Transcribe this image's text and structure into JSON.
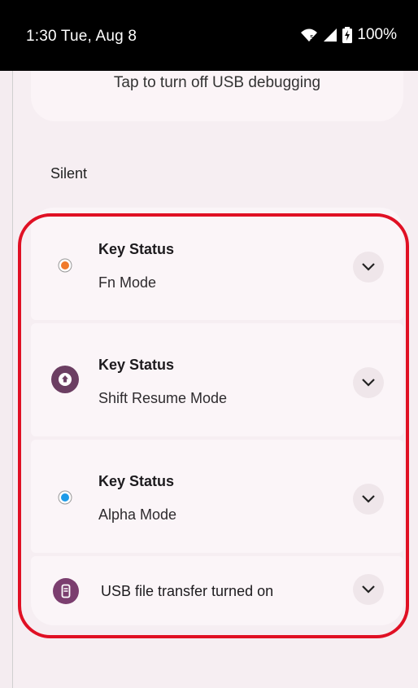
{
  "status_bar": {
    "time": "1:30 Tue, Aug 8",
    "battery": "100%",
    "icons": [
      "wifi-icon",
      "cellular-signal-icon",
      "battery-charging-icon"
    ]
  },
  "debug_card": {
    "text": "Tap to turn off USB debugging"
  },
  "section_label": "Silent",
  "notifications": [
    {
      "title": "Key Status",
      "text": "Fn Mode",
      "icon": "orange-dot-icon",
      "icon_color": "#f07a2a"
    },
    {
      "title": "Key Status",
      "text": "Shift Resume Mode",
      "icon": "shift-mode-icon",
      "icon_color": "#6b3e62"
    },
    {
      "title": "Key Status",
      "text": "Alpha Mode",
      "icon": "blue-dot-icon",
      "icon_color": "#1e9be8"
    },
    {
      "title": "",
      "text": "USB file transfer turned on",
      "icon": "usb-icon",
      "icon_color": "#7b3e6f"
    }
  ],
  "highlight_color": "#e01024"
}
